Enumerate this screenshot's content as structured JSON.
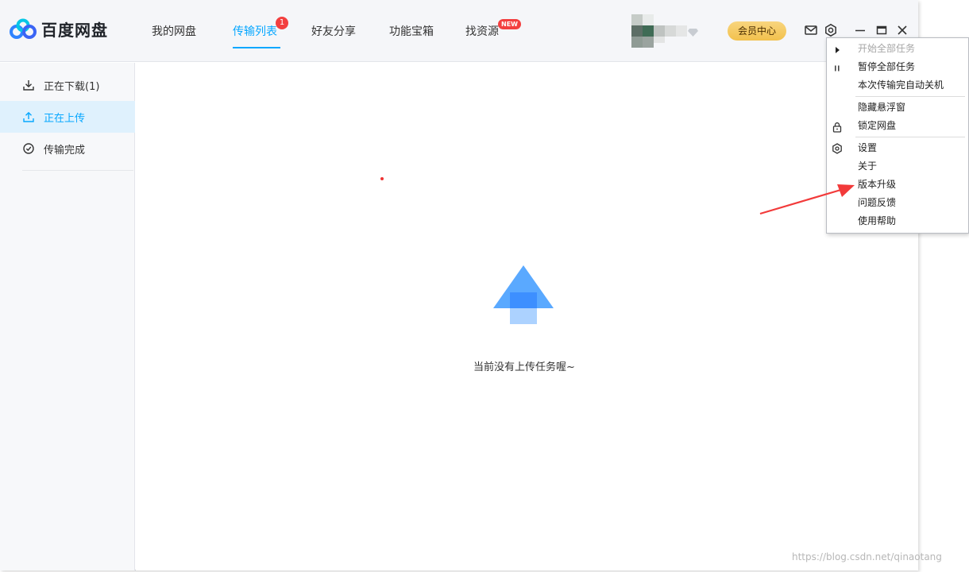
{
  "app": {
    "title": "百度网盘",
    "brand_color": "#06a7ff"
  },
  "nav": {
    "items": [
      {
        "label": "我的网盘"
      },
      {
        "label": "传输列表",
        "badge": "1",
        "active": true
      },
      {
        "label": "好友分享"
      },
      {
        "label": "功能宝箱"
      },
      {
        "label": "找资源",
        "badge": "NEW"
      }
    ]
  },
  "header": {
    "vip_label": "会员中心"
  },
  "sidebar": {
    "items": [
      {
        "label": "正在下载(1)",
        "icon": "download-icon"
      },
      {
        "label": "正在上传",
        "icon": "upload-icon",
        "active": true
      },
      {
        "label": "传输完成",
        "icon": "check-circle-icon"
      }
    ]
  },
  "main": {
    "empty_message": "当前没有上传任务喔~"
  },
  "settings_menu": {
    "items": [
      {
        "label": "开始全部任务",
        "icon": "play-icon",
        "disabled": true
      },
      {
        "label": "暂停全部任务",
        "icon": "pause-icon"
      },
      {
        "label": "本次传输完自动关机"
      },
      {
        "label": "隐藏悬浮窗"
      },
      {
        "label": "锁定网盘",
        "icon": "lock-icon"
      },
      {
        "label": "设置",
        "icon": "gear-icon"
      },
      {
        "label": "关于"
      },
      {
        "label": "版本升级"
      },
      {
        "label": "问题反馈"
      },
      {
        "label": "使用帮助"
      }
    ]
  },
  "watermark": "https://blog.csdn.net/qinaotang"
}
